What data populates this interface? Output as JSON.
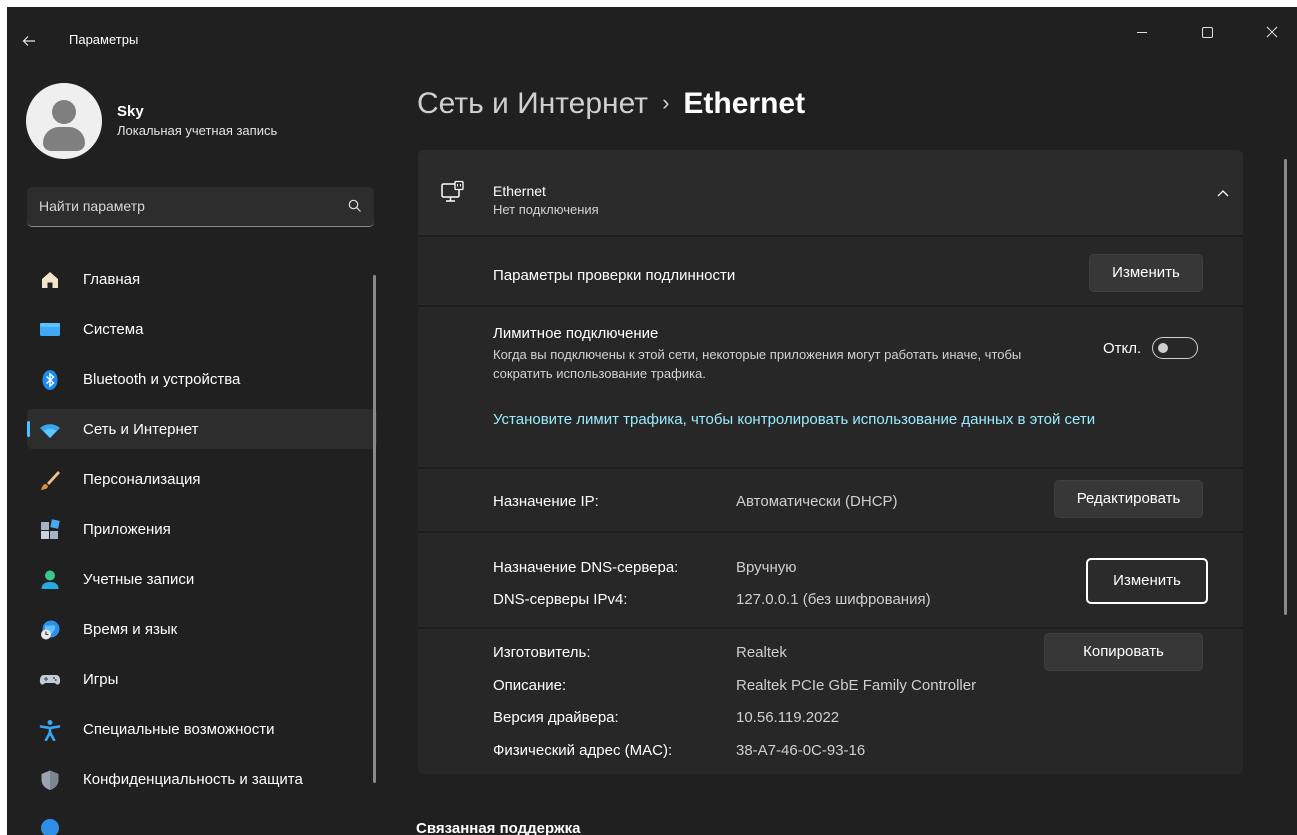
{
  "window": {
    "title": "Параметры",
    "back_icon": "arrow-left-icon",
    "minimize_icon": "minimize-icon",
    "maximize_icon": "maximize-icon",
    "close_icon": "close-icon"
  },
  "profile": {
    "name": "Sky",
    "account_type": "Локальная учетная запись"
  },
  "search": {
    "placeholder": "Найти параметр",
    "icon": "search-icon"
  },
  "sidebar": {
    "items": [
      {
        "label": "Главная",
        "icon": "home-icon"
      },
      {
        "label": "Система",
        "icon": "system-icon"
      },
      {
        "label": "Bluetooth и устройства",
        "icon": "bluetooth-icon"
      },
      {
        "label": "Сеть и Интернет",
        "icon": "wifi-icon",
        "active": true
      },
      {
        "label": "Персонализация",
        "icon": "brush-icon"
      },
      {
        "label": "Приложения",
        "icon": "apps-icon"
      },
      {
        "label": "Учетные записи",
        "icon": "accounts-icon"
      },
      {
        "label": "Время и язык",
        "icon": "globe-clock-icon"
      },
      {
        "label": "Игры",
        "icon": "gamepad-icon"
      },
      {
        "label": "Специальные возможности",
        "icon": "accessibility-icon"
      },
      {
        "label": "Конфиденциальность и защита",
        "icon": "shield-icon"
      }
    ]
  },
  "header": {
    "breadcrumb_parent": "Сеть и Интернет",
    "separator": "›",
    "current": "Ethernet"
  },
  "ethernet_card": {
    "title": "Ethernet",
    "status": "Нет подключения",
    "icon": "ethernet-icon",
    "auth": {
      "label": "Параметры проверки подлинности",
      "button": "Изменить"
    },
    "metered": {
      "label": "Лимитное подключение",
      "description": "Когда вы подключены к этой сети, некоторые приложения могут работать иначе, чтобы сократить использование трафика.",
      "toggle_state": "Откл.",
      "toggle_on": false,
      "link": "Установите лимит трафика, чтобы контролировать использование данных в этой сети"
    },
    "ip": {
      "label": "Назначение IP:",
      "value": "Автоматически (DHCP)",
      "button": "Редактировать"
    },
    "dns": {
      "label": "Назначение DNS-сервера:",
      "value": "Вручную",
      "ipv4_label": "DNS-серверы IPv4:",
      "ipv4_value": "127.0.0.1 (без шифрования)",
      "button": "Изменить"
    },
    "properties": {
      "manufacturer_label": "Изготовитель:",
      "manufacturer": "Realtek",
      "description_label": "Описание:",
      "description": "Realtek PCIe GbE Family Controller",
      "driver_label": "Версия драйвера:",
      "driver": "10.56.119.2022",
      "mac_label": "Физический адрес (MAC):",
      "mac": "38-A7-46-0C-93-16",
      "button": "Копировать"
    }
  },
  "related": {
    "heading": "Связанная поддержка"
  },
  "colors": {
    "background": "#202020",
    "card": "#2b2b2b",
    "accent": "#4cc2ff",
    "link": "#99ebff"
  }
}
